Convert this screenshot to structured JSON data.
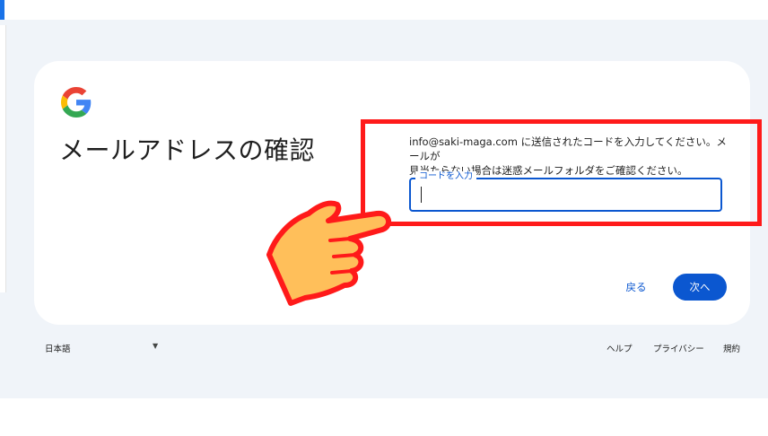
{
  "icons": {
    "logo": "google-g-logo",
    "hand": "pointing-hand-icon",
    "dropdown": "caret-down-icon"
  },
  "colors": {
    "accent": "#0b57d0",
    "highlight": "#ff1a1a",
    "background": "#f0f4f9"
  },
  "card": {
    "title": "メールアドレスの確認",
    "description_line1": "info@saki-maga.com に送信されたコードを入力してください。メールが",
    "description_line2": "見当たらない場合は迷惑メールフォルダをご確認ください。",
    "code_field": {
      "label": "コードを入力",
      "value": ""
    },
    "back_label": "戻る",
    "next_label": "次へ"
  },
  "footer": {
    "language": "日本語",
    "help": "ヘルプ",
    "privacy": "プライバシー",
    "terms": "規約"
  }
}
